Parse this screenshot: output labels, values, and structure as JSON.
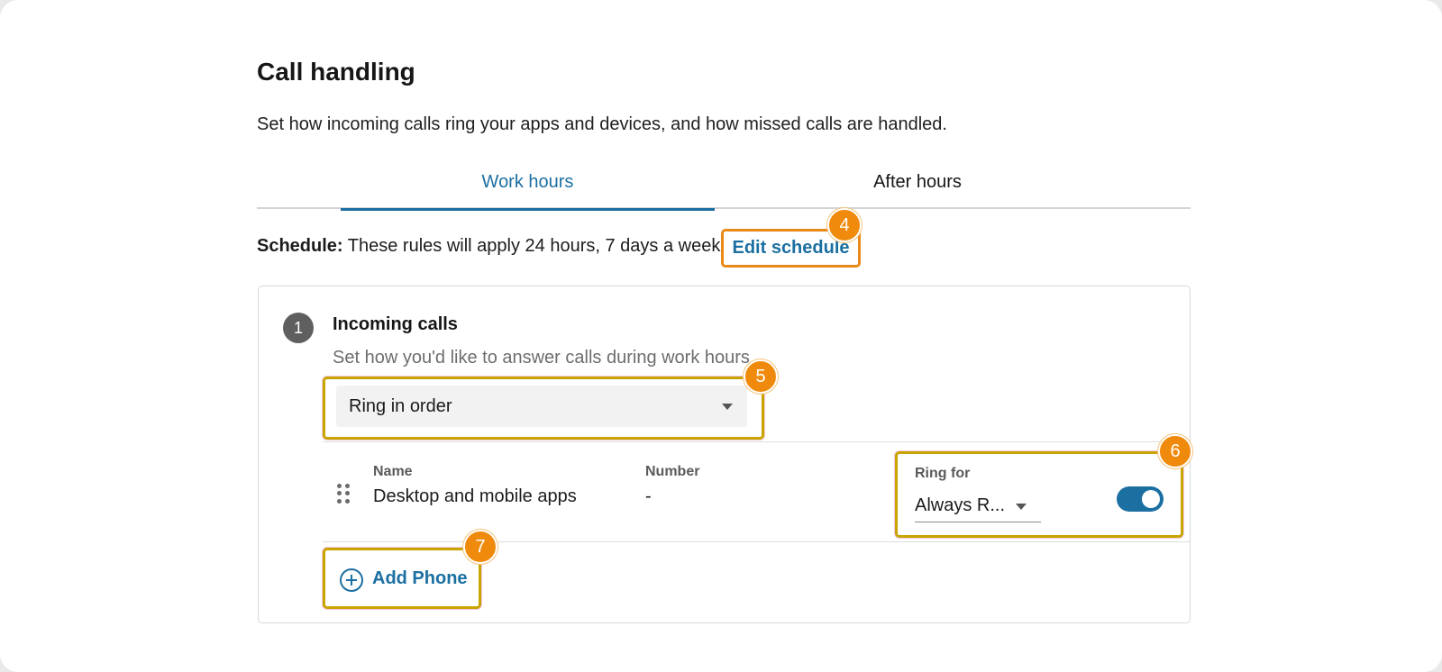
{
  "header": {
    "title": "Call handling",
    "description": "Set how incoming calls ring your apps and devices, and how missed calls are handled."
  },
  "tabs": [
    {
      "label": "Work hours",
      "active": true
    },
    {
      "label": "After hours",
      "active": false
    }
  ],
  "schedule": {
    "label": "Schedule:",
    "text": " These rules will apply 24 hours, 7 days a week.",
    "edit_label": "Edit schedule"
  },
  "badges": {
    "b4": "4",
    "b5": "5",
    "b6": "6",
    "b7": "7"
  },
  "incoming": {
    "step": "1",
    "title": "Incoming calls",
    "subtitle": "Set how you'd like to answer calls during work hours",
    "ring_mode": "Ring in order"
  },
  "devices": {
    "columns": {
      "name": "Name",
      "number": "Number",
      "ring_for": "Ring for"
    },
    "rows": [
      {
        "name": "Desktop and mobile apps",
        "number": "-",
        "ring_for": "Always R...",
        "enabled": true
      }
    ]
  },
  "add_phone": {
    "label": "Add Phone"
  },
  "colors": {
    "accent": "#1b6fa1",
    "badge": "#f08a0c",
    "highlight_outline": "#c8a500",
    "edit_outline": "#e8891a"
  }
}
